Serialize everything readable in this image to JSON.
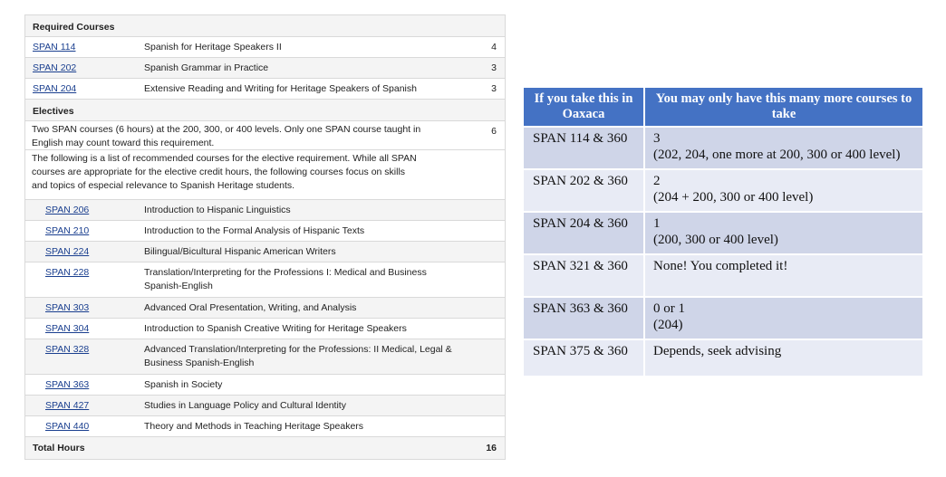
{
  "required": {
    "heading": "Required Courses",
    "courses": [
      {
        "code": "SPAN 114",
        "title": "Spanish for Heritage Speakers II",
        "hours": "4"
      },
      {
        "code": "SPAN 202",
        "title": "Spanish Grammar in Practice",
        "hours": "3"
      },
      {
        "code": "SPAN 204",
        "title": "Extensive Reading and Writing for Heritage Speakers of Spanish",
        "hours": "3"
      }
    ]
  },
  "electives": {
    "heading": "Electives",
    "description": "Two SPAN courses (6 hours) at the 200, 300, or 400 levels. Only one SPAN course taught in English may count toward this requirement.",
    "hours": "6",
    "recommendation": "The following is a list of recommended courses for the elective requirement. While all SPAN courses are appropriate for the elective credit hours, the following courses focus on skills and topics of especial relevance to Spanish Heritage students.",
    "courses": [
      {
        "code": "SPAN 206",
        "title": "Introduction to Hispanic Linguistics"
      },
      {
        "code": "SPAN 210",
        "title": "Introduction to the Formal Analysis of Hispanic Texts"
      },
      {
        "code": "SPAN 224",
        "title": "Bilingual/Bicultural Hispanic American Writers"
      },
      {
        "code": "SPAN 228",
        "title": "Translation/Interpreting for the Professions I: Medical and Business Spanish-English"
      },
      {
        "code": "SPAN 303",
        "title": "Advanced Oral Presentation, Writing, and Analysis"
      },
      {
        "code": "SPAN 304",
        "title": "Introduction to Spanish Creative Writing for Heritage Speakers"
      },
      {
        "code": "SPAN 328",
        "title": "Advanced Translation/Interpreting for the Professions: II Medical, Legal & Business Spanish-English"
      },
      {
        "code": "SPAN 363",
        "title": "Spanish in Society"
      },
      {
        "code": "SPAN 427",
        "title": "Studies in Language Policy and Cultural Identity"
      },
      {
        "code": "SPAN 440",
        "title": "Theory and Methods in Teaching Heritage Speakers"
      }
    ]
  },
  "total": {
    "label": "Total Hours",
    "hours": "16"
  },
  "oaxaca": {
    "headers": [
      "If you take this in Oaxaca",
      "You may only have this many more courses to take"
    ],
    "rows": [
      {
        "course": "SPAN 114 & 360",
        "count": "3",
        "note": "(202, 204, one more at 200, 300 or 400 level)"
      },
      {
        "course": "SPAN 202 & 360",
        "count": "2",
        "note": "(204 + 200, 300 or 400 level)"
      },
      {
        "course": "SPAN 204 & 360",
        "count": "1",
        "note": "(200, 300 or 400 level)"
      },
      {
        "course": "SPAN 321 & 360",
        "count": "None! You completed it!",
        "note": ""
      },
      {
        "course": "SPAN 363 & 360",
        "count": "0 or 1",
        "note": "(204)"
      },
      {
        "course": "SPAN 375 & 360",
        "count": "Depends, seek advising",
        "note": ""
      }
    ]
  }
}
